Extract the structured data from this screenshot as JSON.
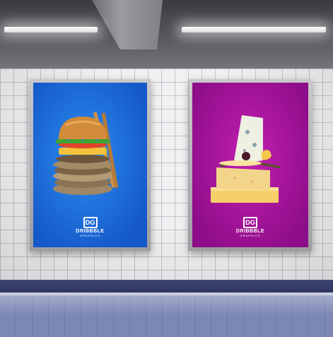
{
  "posters": [
    {
      "brand_mark": "DG",
      "brand_name": "DRIBBBLE",
      "brand_sub": "GRAPHICS",
      "subject": "burger"
    },
    {
      "brand_mark": "DG",
      "brand_name": "DRIBBBLE",
      "brand_sub": "GRAPHICS",
      "subject": "cheese"
    }
  ],
  "colors": {
    "poster_left": "#1c6fe0",
    "poster_right": "#b018a6",
    "wall": "#f1f1f3",
    "floor": "#7b85b3"
  }
}
